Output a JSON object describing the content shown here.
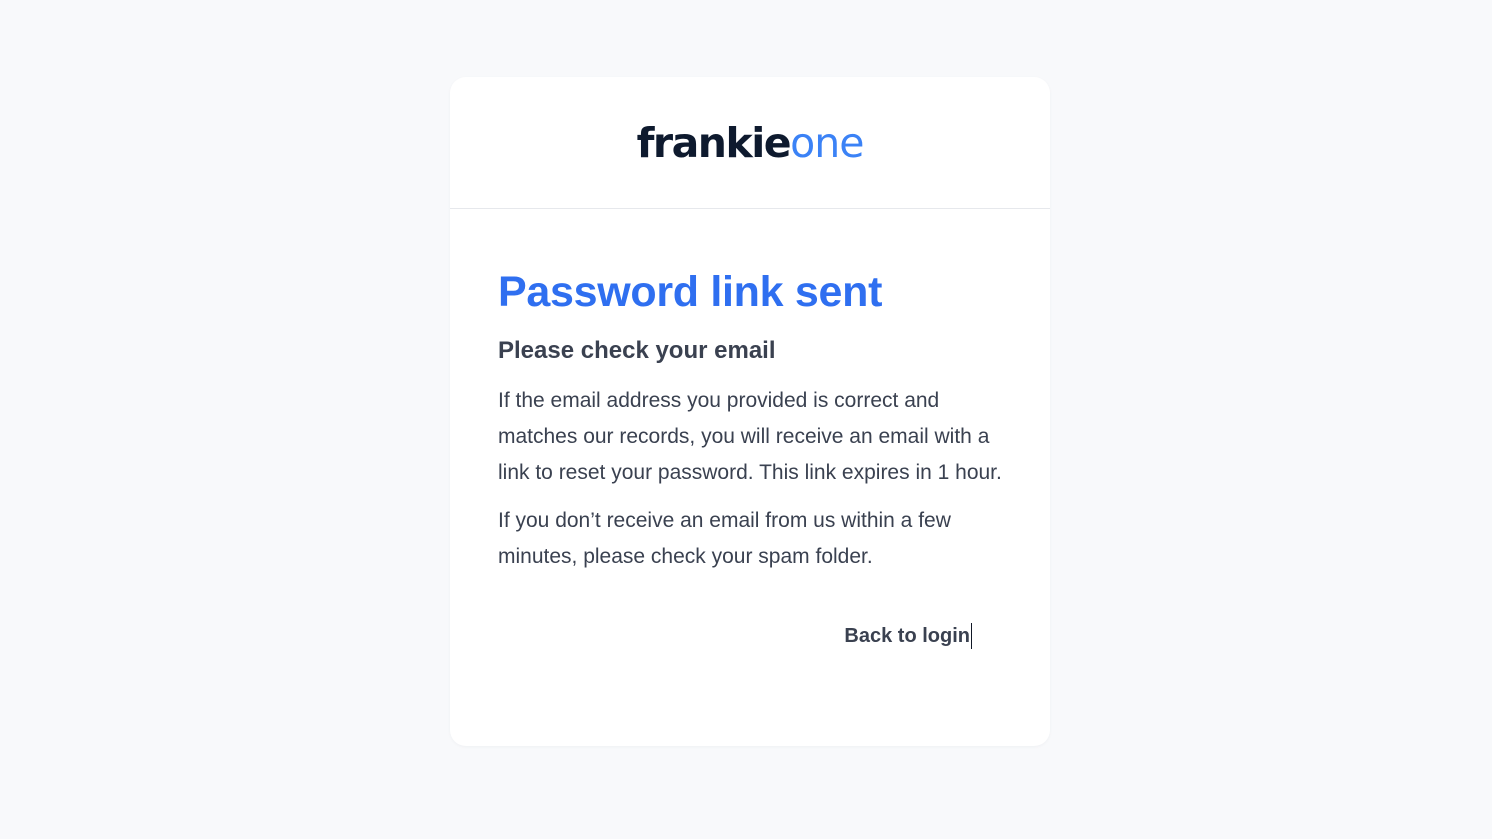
{
  "brand": {
    "logo_part1": "frankie",
    "logo_part2": "one",
    "colors": {
      "dark": "#0e1a2e",
      "accent": "#3b82f6"
    }
  },
  "main": {
    "title": "Password link sent",
    "subtitle": "Please check your email",
    "paragraph_1": "If the email address you provided is correct and matches our records, you will receive an email with a link to reset your password. This link expires in 1 hour.",
    "paragraph_2": "If you don’t receive an email from us within a few minutes, please check your spam folder.",
    "back_link_label": "Back to login"
  },
  "colors": {
    "title": "#2f6ff0",
    "text": "#3a4150",
    "background": "#f8f9fb",
    "card": "#ffffff"
  }
}
